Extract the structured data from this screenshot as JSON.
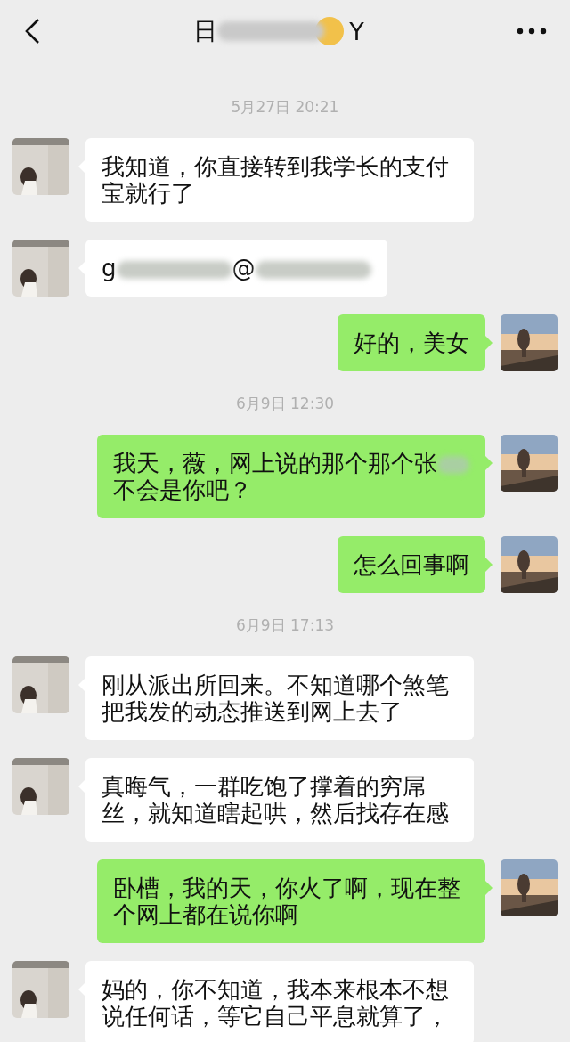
{
  "header": {
    "title": [
      {
        "kind": "text",
        "text": "日"
      },
      {
        "kind": "blur"
      },
      {
        "kind": "emoji"
      },
      {
        "kind": "text",
        "text": "Y"
      }
    ]
  },
  "chat": [
    {
      "kind": "time",
      "text": "5月27日 20:21"
    },
    {
      "kind": "message",
      "outgoing": false,
      "segments": [
        {
          "kind": "text",
          "text": "我知道，你直接转到我学长的支付宝就行了"
        }
      ]
    },
    {
      "kind": "message",
      "outgoing": false,
      "segments": [
        {
          "kind": "text",
          "text": "g"
        },
        {
          "kind": "blur"
        },
        {
          "kind": "text",
          "text": "@"
        },
        {
          "kind": "blur"
        }
      ]
    },
    {
      "kind": "message",
      "outgoing": true,
      "segments": [
        {
          "kind": "text",
          "text": "好的，美女"
        }
      ]
    },
    {
      "kind": "time",
      "text": "6月9日 12:30"
    },
    {
      "kind": "message",
      "outgoing": true,
      "segments": [
        {
          "kind": "text",
          "text": "我天，薇，网上说的那个那个张"
        },
        {
          "kind": "blur"
        },
        {
          "kind": "break"
        },
        {
          "kind": "text",
          "text": "不会是你吧？"
        }
      ]
    },
    {
      "kind": "message",
      "outgoing": true,
      "segments": [
        {
          "kind": "text",
          "text": "怎么回事啊"
        }
      ]
    },
    {
      "kind": "time",
      "text": "6月9日 17:13"
    },
    {
      "kind": "message",
      "outgoing": false,
      "segments": [
        {
          "kind": "text",
          "text": "刚从派出所回来。不知道哪个煞笔把我发的动态推送到网上去了"
        }
      ]
    },
    {
      "kind": "message",
      "outgoing": false,
      "segments": [
        {
          "kind": "text",
          "text": "真晦气，一群吃饱了撑着的穷屌丝，就知道瞎起哄，然后找存在感"
        }
      ]
    },
    {
      "kind": "message",
      "outgoing": true,
      "segments": [
        {
          "kind": "text",
          "text": "卧槽，我的天，你火了啊，现在整个网上都在说你啊"
        }
      ]
    },
    {
      "kind": "message",
      "outgoing": false,
      "segments": [
        {
          "kind": "text",
          "text": "妈的，你不知道，我本来根本不想说任何话，等它自己平息就算了，"
        }
      ]
    }
  ]
}
